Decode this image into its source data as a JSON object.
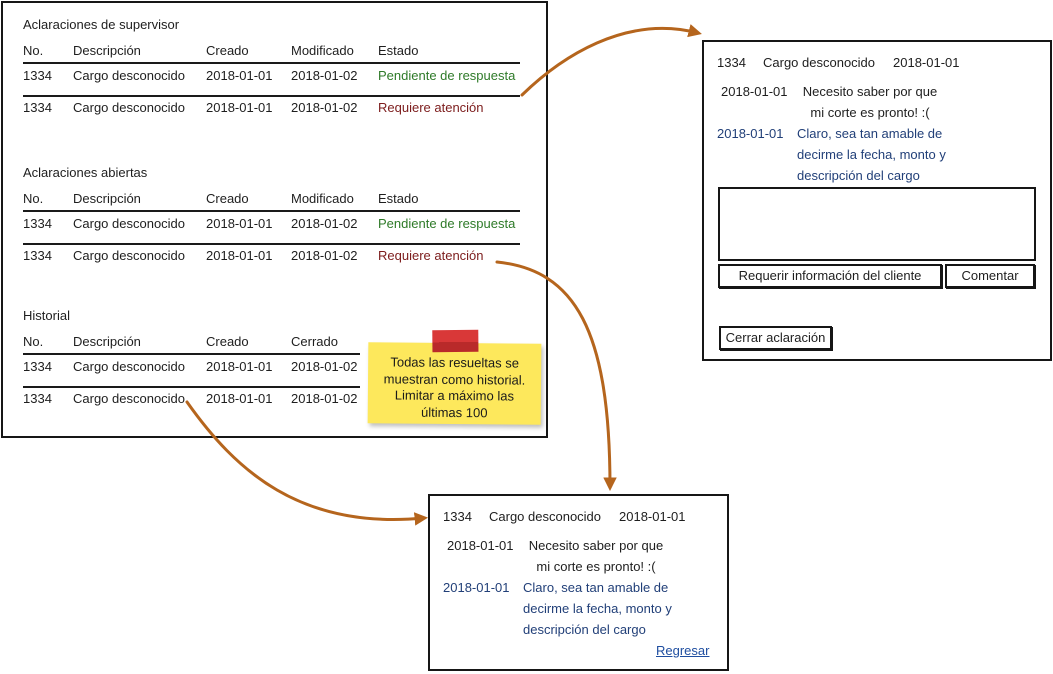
{
  "colors": {
    "text": "#1e1e1e",
    "pending": "#2e7a28",
    "attention": "#7c1c1c",
    "reply": "#213f78",
    "link": "#1f4ea0",
    "arrow": "#b5651d",
    "sticky": "#fde85c",
    "tape": "#d93838"
  },
  "supervisor": {
    "title": "Aclaraciones de supervisor",
    "columns": [
      "No.",
      "Descripción",
      "Creado",
      "Modificado",
      "Estado"
    ],
    "rows": [
      {
        "id": "1334",
        "description": "Cargo desconocido",
        "created": "2018-01-01",
        "modified": "2018-01-02",
        "status": "Pendiente de respuesta"
      },
      {
        "id": "1334",
        "description": "Cargo desconocido",
        "created": "2018-01-01",
        "modified": "2018-01-02",
        "status": "Requiere atención"
      }
    ]
  },
  "open": {
    "title": "Aclaraciones abiertas",
    "columns": [
      "No.",
      "Descripción",
      "Creado",
      "Modificado",
      "Estado"
    ],
    "rows": [
      {
        "id": "1334",
        "description": "Cargo desconocido",
        "created": "2018-01-01",
        "modified": "2018-01-02",
        "status": "Pendiente de respuesta"
      },
      {
        "id": "1334",
        "description": "Cargo desconocido",
        "created": "2018-01-01",
        "modified": "2018-01-02",
        "status": "Requiere atención"
      }
    ]
  },
  "history": {
    "title": "Historial",
    "columns": [
      "No.",
      "Descripción",
      "Creado",
      "Cerrado"
    ],
    "rows": [
      {
        "id": "1334",
        "description": "Cargo desconocido",
        "created": "2018-01-01",
        "closed": "2018-01-02"
      },
      {
        "id": "1334",
        "description": "Cargo desconocido",
        "created": "2018-01-01",
        "closed": "2018-01-02"
      }
    ]
  },
  "note": {
    "text": "Todas las resueltas se muestran como historial. Limitar a máximo las últimas 100"
  },
  "detail_editable": {
    "header": {
      "id": "1334",
      "description": "Cargo desconocido",
      "date": "2018-01-01"
    },
    "messages": [
      {
        "date": "2018-01-01",
        "text": "Necesito saber por que mi corte es pronto! :("
      },
      {
        "date": "2018-01-01",
        "text": "Claro, sea tan amable de decirme la fecha, monto y descripción del cargo"
      }
    ],
    "buttons": {
      "request_info": "Requerir información del cliente",
      "comment": "Comentar",
      "close": "Cerrar aclaración"
    }
  },
  "detail_readonly": {
    "header": {
      "id": "1334",
      "description": "Cargo desconocido",
      "date": "2018-01-01"
    },
    "messages": [
      {
        "date": "2018-01-01",
        "text": "Necesito saber por que mi corte es pronto! :("
      },
      {
        "date": "2018-01-01",
        "text": "Claro, sea tan amable de decirme la fecha, monto y descripción del cargo"
      }
    ],
    "back_link": "Regresar"
  }
}
